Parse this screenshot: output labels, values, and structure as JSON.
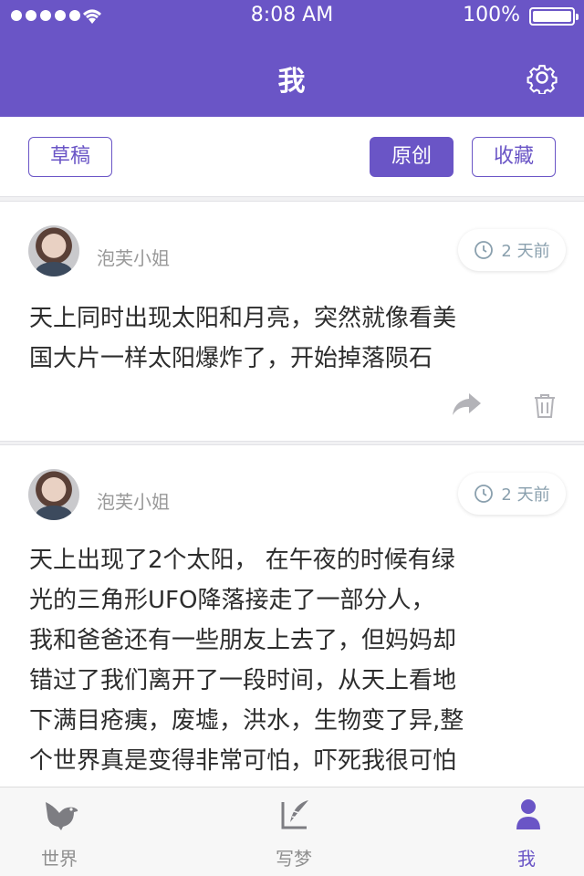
{
  "status_bar": {
    "time": "8:08 AM",
    "battery": "100%"
  },
  "nav": {
    "title": "我",
    "settings_icon": "gear-icon"
  },
  "filters": {
    "draft": "草稿",
    "original": "原创",
    "favorites": "收藏",
    "active": "original"
  },
  "posts": [
    {
      "author": "泡芙小姐",
      "time": "2 天前",
      "lines": [
        "天上同时出现太阳和月亮，突然就像看美",
        "国大片一样太阳爆炸了，开始掉落陨石"
      ]
    },
    {
      "author": "泡芙小姐",
      "time": "2 天前",
      "lines": [
        "天上出现了2个太阳， 在午夜的时候有绿",
        "光的三角形UFO降落接走了一部分人，",
        "我和爸爸还有一些朋友上去了，但妈妈却",
        "错过了我们离开了一段时间，从天上看地",
        "下满目疮痍，废墟，洪水，生物变了异,整",
        "个世界真是变得非常可怕，吓死我很可怕"
      ]
    }
  ],
  "tabs": [
    {
      "label": "世界",
      "icon": "bird-icon"
    },
    {
      "label": "写梦",
      "icon": "quill-icon"
    },
    {
      "label": "我",
      "icon": "person-icon"
    }
  ],
  "colors": {
    "accent": "#6a55c6",
    "muted": "#8f8f8f"
  }
}
